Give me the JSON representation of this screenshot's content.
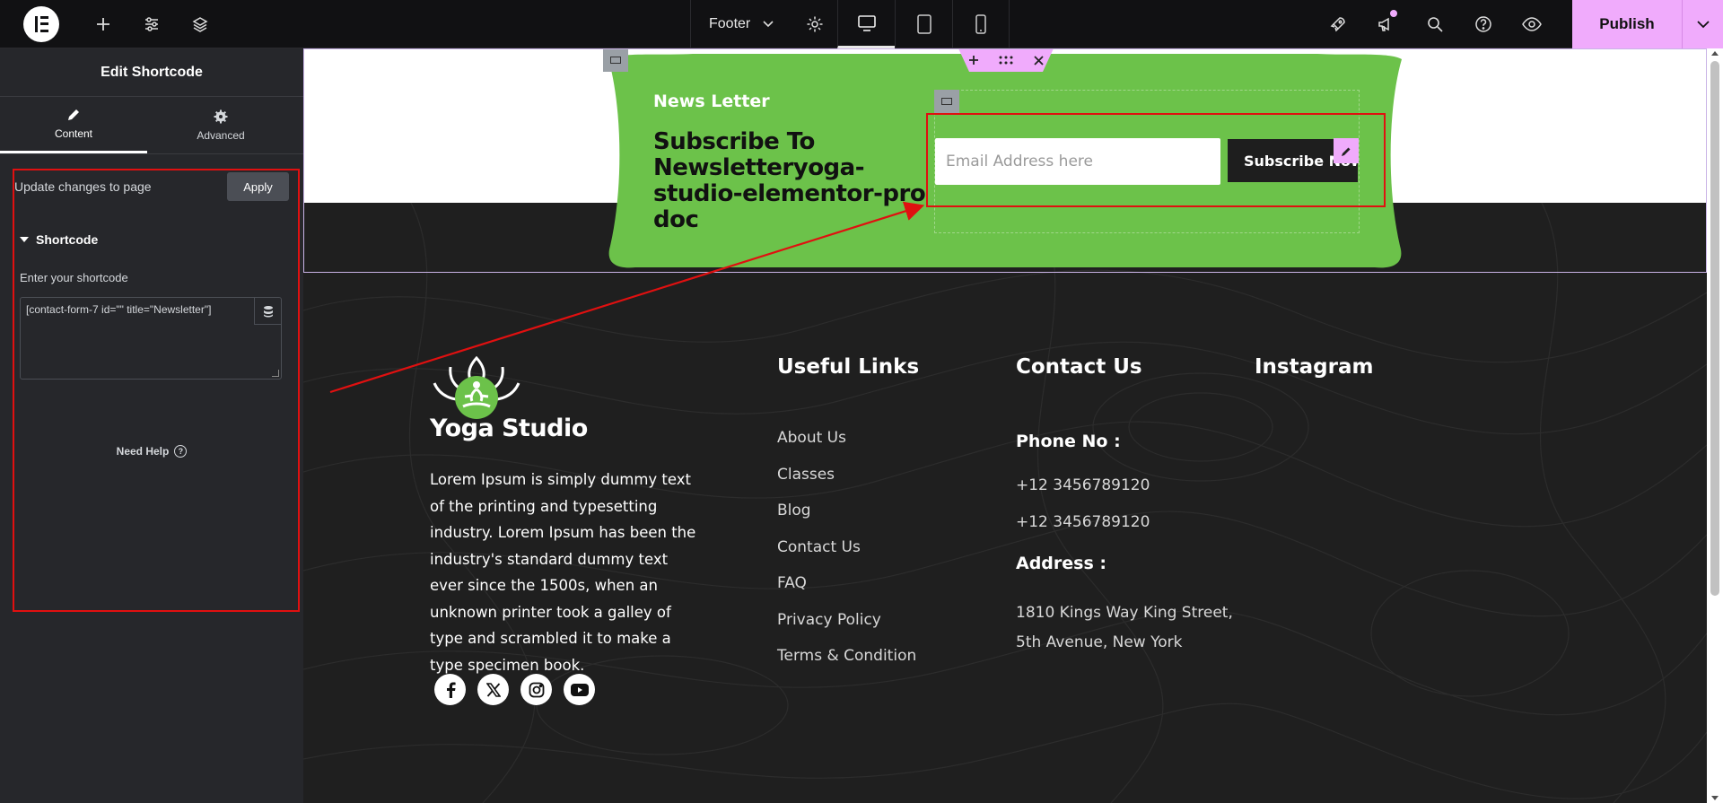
{
  "topbar": {
    "document_name": "Footer",
    "publish_label": "Publish"
  },
  "sidebar": {
    "title": "Edit Shortcode",
    "tabs": [
      {
        "label": "Content"
      },
      {
        "label": "Advanced"
      }
    ],
    "update_text": "Update changes to page",
    "apply_label": "Apply",
    "section_title": "Shortcode",
    "field_label": "Enter your shortcode",
    "shortcode_value": "[contact-form-7 id=\"\" title=\"Newsletter\"]",
    "need_help": "Need Help",
    "help_glyph": "?"
  },
  "newsletter": {
    "label": "News Letter",
    "title": "Subscribe To Newsletteryoga-studio-elementor-pro doc",
    "email_placeholder": "Email Address here",
    "button_label": "Subscribe Now"
  },
  "footer": {
    "brand": "Yoga Studio",
    "description": "Lorem Ipsum is simply dummy text of the printing and typesetting industry. Lorem Ipsum has been the industry's standard dummy text ever since the 1500s, when an unknown printer took a galley of type and scrambled it to make a type specimen book.",
    "useful_links_title": "Useful Links",
    "useful_links": [
      "About Us",
      "Classes",
      "Blog",
      "Contact Us",
      "FAQ",
      "Privacy Policy",
      "Terms & Condition"
    ],
    "contact_title": "Contact Us",
    "phone_label": "Phone No :",
    "phones": [
      "+12 3456789120",
      "+12 3456789120"
    ],
    "address_label": "Address :",
    "address_lines": [
      "1810 Kings Way King Street,",
      "5th Avenue, New York"
    ],
    "instagram_title": "Instagram",
    "socials": [
      "facebook-icon",
      "x-icon",
      "instagram-icon",
      "youtube-icon"
    ]
  },
  "colors": {
    "accent_green": "#6cc24a",
    "publish_pink": "#f0abfc",
    "annotation_red": "#e01010",
    "dark_bg": "#1f1f1f"
  }
}
